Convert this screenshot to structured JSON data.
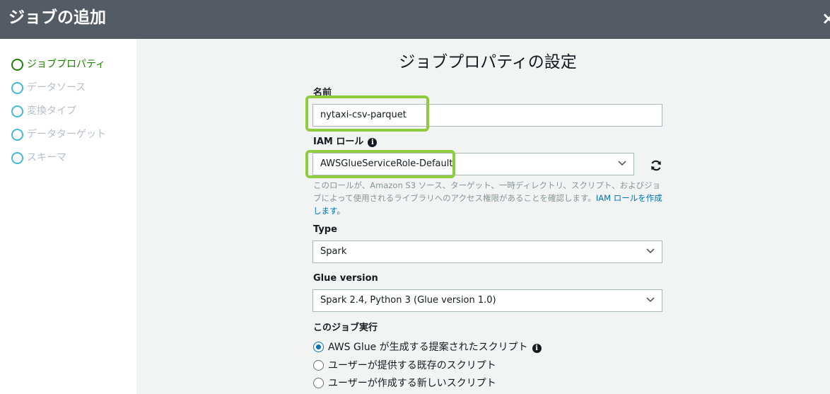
{
  "header": {
    "title": "ジョブの追加",
    "close_symbol": "×"
  },
  "sidebar": {
    "steps": [
      {
        "label": "ジョブプロパティ",
        "active": true
      },
      {
        "label": "データソース",
        "active": false
      },
      {
        "label": "変換タイプ",
        "active": false
      },
      {
        "label": "データターゲット",
        "active": false
      },
      {
        "label": "スキーマ",
        "active": false
      }
    ]
  },
  "main": {
    "title": "ジョブプロパティの設定",
    "name_field": {
      "label": "名前",
      "value": "nytaxi-csv-parquet"
    },
    "iam_role": {
      "label": "IAM ロール",
      "value": "AWSGlueServiceRole-Default",
      "help_text": "このロールが、Amazon S3 ソース、ターゲット、一時ディレクトリ、スクリプト、およびジョブによって使用されるライブラリへのアクセス権限があることを確認します。",
      "help_link": "IAM ロールを作成します。"
    },
    "type": {
      "label": "Type",
      "value": "Spark"
    },
    "glue_version": {
      "label": "Glue version",
      "value": "Spark 2.4, Python 3 (Glue version 1.0)"
    },
    "job_run": {
      "label": "このジョブ実行",
      "options": [
        {
          "label": "AWS Glue が生成する提案されたスクリプト",
          "checked": true
        },
        {
          "label": "ユーザーが提供する既存のスクリプト",
          "checked": false
        },
        {
          "label": "ユーザーが作成する新しいスクリプト",
          "checked": false
        }
      ]
    }
  },
  "colors": {
    "header_bg": "#545b64",
    "active_step": "#1d8102",
    "inactive_step_circle": "#44b9d6",
    "highlight": "#8fcc3d",
    "link": "#0073bb"
  }
}
